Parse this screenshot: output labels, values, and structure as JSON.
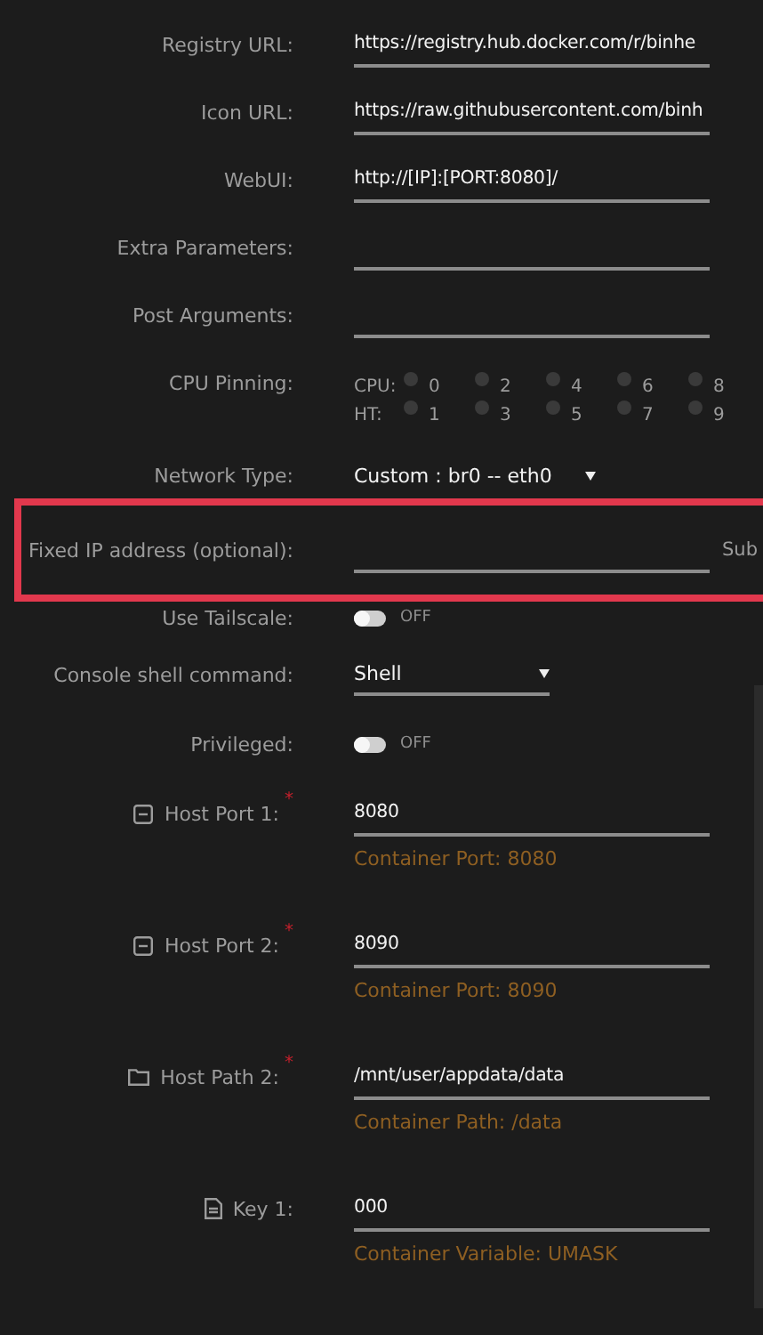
{
  "fields": [
    {
      "kind": "text",
      "label": "Registry URL:",
      "value": "https://registry.hub.docker.com/r/binhe"
    },
    {
      "kind": "text",
      "label": "Icon URL:",
      "value": "https://raw.githubusercontent.com/binh"
    },
    {
      "kind": "text",
      "label": "WebUI:",
      "value": "http://[IP]:[PORT:8080]/"
    },
    {
      "kind": "text",
      "label": "Extra Parameters:"
    },
    {
      "kind": "text",
      "label": "Post Arguments:"
    },
    {
      "kind": "cpu",
      "label": "CPU Pinning:",
      "rows": [
        {
          "label": "CPU:",
          "cores": [
            {
              "label": "0",
              "checked": false
            },
            {
              "label": "2",
              "checked": false
            },
            {
              "label": "4",
              "checked": false
            },
            {
              "label": "6",
              "checked": false
            },
            {
              "label": "8",
              "checked": false
            }
          ]
        },
        {
          "label": "HT:",
          "cores": [
            {
              "label": "1",
              "checked": false
            },
            {
              "label": "3",
              "checked": false
            },
            {
              "label": "5",
              "checked": false
            },
            {
              "label": "7",
              "checked": false
            },
            {
              "label": "9",
              "checked": false
            }
          ]
        }
      ]
    },
    {
      "kind": "select",
      "label": "Network Type:",
      "value": "Custom : br0 -- eth0",
      "underlined": false
    },
    {
      "kind": "text",
      "label": "Fixed IP address (optional):",
      "highlighted": true,
      "trailing": "Sub"
    },
    {
      "kind": "toggle",
      "label": "Use Tailscale:",
      "on": false,
      "state_text": "OFF"
    },
    {
      "kind": "select",
      "label": "Console shell command:",
      "value": "Shell",
      "underlined": true
    },
    {
      "kind": "toggle",
      "label": "Privileged:",
      "on": false,
      "state_text": "OFF"
    },
    {
      "kind": "port",
      "label": "Host Port 1:",
      "required_mark": "*",
      "value": "8080",
      "note": "Container Port: 8080"
    },
    {
      "kind": "port",
      "label": "Host Port 2:",
      "required_mark": "*",
      "value": "8090",
      "note": "Container Port: 8090"
    },
    {
      "kind": "path",
      "label": "Host Path 2:",
      "required_mark": "*",
      "value": "/mnt/user/appdata/data",
      "note": "Container Path: /data"
    },
    {
      "kind": "variable",
      "label": "Key 1:",
      "value": "000",
      "note": "Container Variable: UMASK"
    }
  ]
}
